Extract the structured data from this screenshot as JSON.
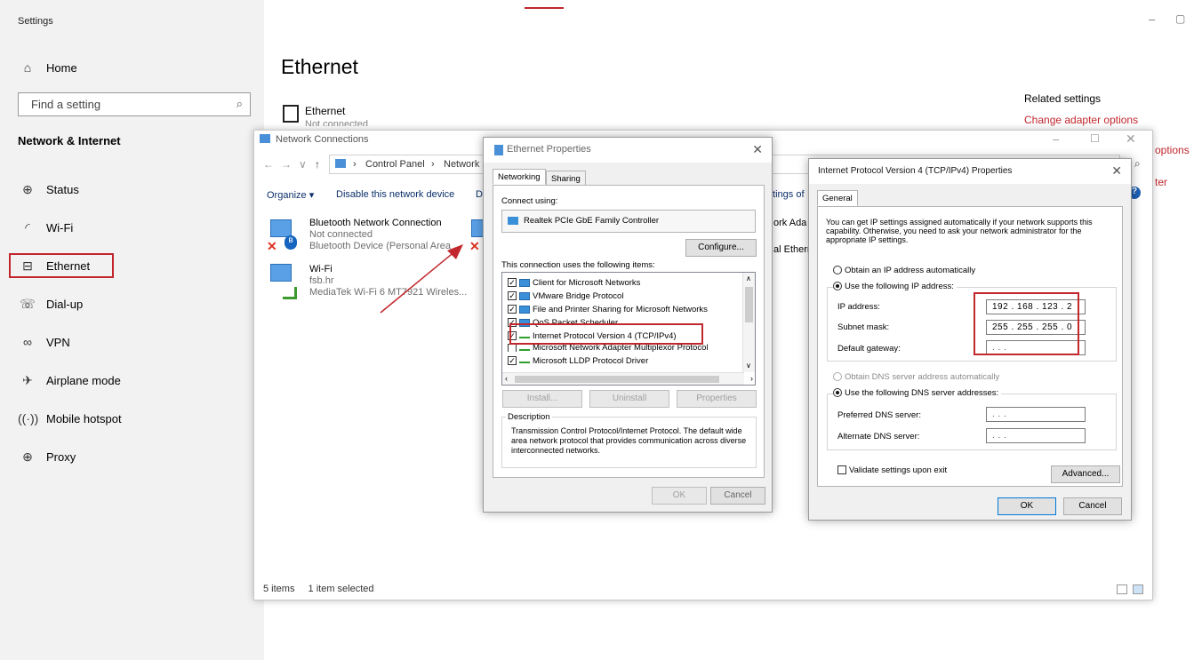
{
  "settings": {
    "app_title": "Settings",
    "home": "Home",
    "search_placeholder": "Find a setting",
    "section": "Network & Internet",
    "nav": [
      {
        "label": "Status",
        "icon": "globe-icon"
      },
      {
        "label": "Wi-Fi",
        "icon": "wifi-icon"
      },
      {
        "label": "Ethernet",
        "icon": "ethernet-icon"
      },
      {
        "label": "Dial-up",
        "icon": "dialup-icon"
      },
      {
        "label": "VPN",
        "icon": "vpn-icon"
      },
      {
        "label": "Airplane mode",
        "icon": "airplane-icon"
      },
      {
        "label": "Mobile hotspot",
        "icon": "hotspot-icon"
      },
      {
        "label": "Proxy",
        "icon": "proxy-icon"
      }
    ],
    "page_title": "Ethernet",
    "ethernet_item": "Ethernet",
    "ethernet_item_status": "Not connected",
    "related_title": "Related settings",
    "related_link": "Change adapter options",
    "clipped_1": "options",
    "clipped_2": "ter"
  },
  "network_connections": {
    "title": "Network Connections",
    "breadcrumb": [
      "Control Panel",
      "Network a"
    ],
    "toolbar": [
      "Organize ▾",
      "Disable this network device",
      "Di",
      "ttings of"
    ],
    "connections": [
      {
        "name": "Bluetooth Network Connection",
        "status": "Not connected",
        "device": "Bluetooth Device (Personal Area ..."
      },
      {
        "name": "Wi-Fi",
        "status": "fsb.hr",
        "device": "MediaTek Wi-Fi 6 MT7921 Wireles..."
      }
    ],
    "clipped_right": [
      "ork Ada",
      "al Ethern"
    ],
    "status_items": "5 items",
    "status_selected": "1 item selected"
  },
  "eth_props": {
    "title": "Ethernet Properties",
    "tabs": [
      "Networking",
      "Sharing"
    ],
    "connect_using": "Connect using:",
    "adapter": "Realtek PCIe GbE Family Controller",
    "configure": "Configure...",
    "items_label": "This connection uses the following items:",
    "items": [
      "Client for Microsoft Networks",
      "VMware Bridge Protocol",
      "File and Printer Sharing for Microsoft Networks",
      "QoS Packet Scheduler",
      "Internet Protocol Version 4 (TCP/IPv4)",
      "Microsoft Network Adapter Multiplexor Protocol",
      "Microsoft LLDP Protocol Driver"
    ],
    "install": "Install...",
    "uninstall": "Uninstall",
    "properties": "Properties",
    "description_label": "Description",
    "description": "Transmission Control Protocol/Internet Protocol. The default wide area network protocol that provides communication across diverse interconnected networks.",
    "ok": "OK",
    "cancel": "Cancel"
  },
  "ipv4": {
    "title": "Internet Protocol Version 4 (TCP/IPv4) Properties",
    "tab": "General",
    "intro": "You can get IP settings assigned automatically if your network supports this capability. Otherwise, you need to ask your network administrator for the appropriate IP settings.",
    "obtain_ip": "Obtain an IP address automatically",
    "use_ip": "Use the following IP address:",
    "ip_label": "IP address:",
    "ip_value": "192 . 168 . 123 . 2",
    "mask_label": "Subnet mask:",
    "mask_value": "255 . 255 . 255 . 0",
    "gw_label": "Default gateway:",
    "gw_value": ".       .       .",
    "obtain_dns": "Obtain DNS server address automatically",
    "use_dns": "Use the following DNS server addresses:",
    "pref_dns_label": "Preferred DNS server:",
    "pref_dns_value": ".       .       .",
    "alt_dns_label": "Alternate DNS server:",
    "alt_dns_value": ".       .       .",
    "validate": "Validate settings upon exit",
    "advanced": "Advanced...",
    "ok": "OK",
    "cancel": "Cancel"
  }
}
